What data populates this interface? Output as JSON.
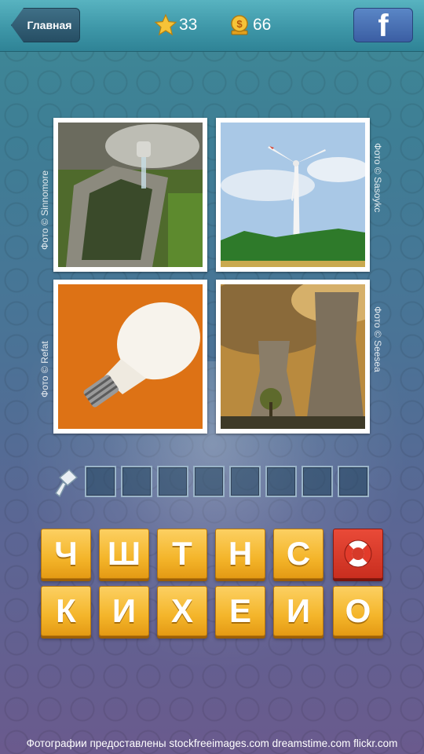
{
  "topbar": {
    "back_label": "Главная",
    "stars": "33",
    "coins": "66",
    "facebook_glyph": "f"
  },
  "photos": [
    {
      "credit": "Фото © Sinnomore",
      "subject": "water-spring-icon"
    },
    {
      "credit": "Фото © Sasoykc",
      "subject": "wind-turbine-icon"
    },
    {
      "credit": "Фото © Refat",
      "subject": "light-bulb-icon"
    },
    {
      "credit": "Фото © Seesea",
      "subject": "cooling-towers-icon"
    }
  ],
  "answer": {
    "slot_count": 8,
    "hint_icon": "hammer-icon"
  },
  "letters": {
    "row1": [
      "Ч",
      "Ш",
      "Т",
      "Н",
      "С"
    ],
    "row2": [
      "К",
      "И",
      "Х",
      "Е",
      "И",
      "О"
    ],
    "help_icon": "lifebuoy-icon"
  },
  "colors": {
    "tile": "#f4b52a",
    "help_tile": "#d63a2a",
    "facebook": "#3b5ea3"
  },
  "footer": "Фотографии предоставлены  stockfreeimages.com dreamstime.com flickr.com"
}
